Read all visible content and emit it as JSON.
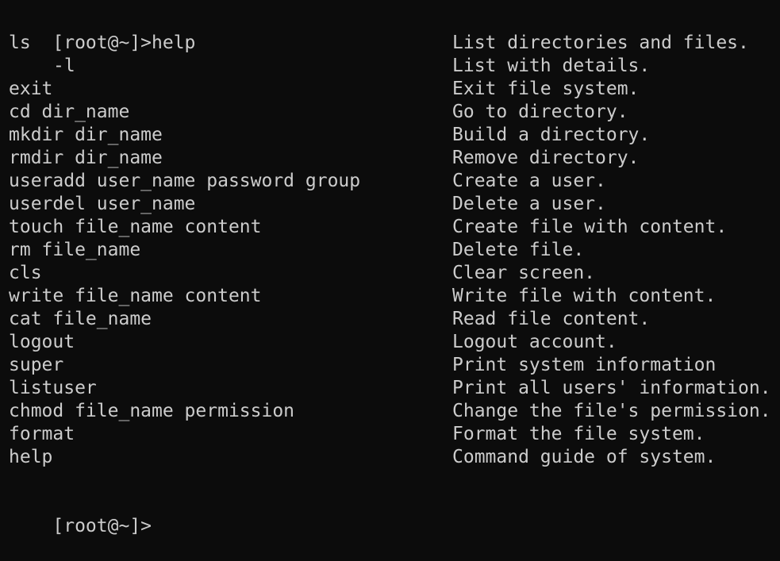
{
  "terminal": {
    "first_prompt": "[root@~]>",
    "first_command": "help",
    "last_prompt": "[root@~]>",
    "help_rows": [
      {
        "command": "ls",
        "description": "List directories and files."
      },
      {
        "command": "-l",
        "description": "List with details.",
        "indent": true
      },
      {
        "command": "exit",
        "description": "Exit file system."
      },
      {
        "command": "cd dir_name",
        "description": "Go to directory."
      },
      {
        "command": "mkdir dir_name",
        "description": "Build a directory."
      },
      {
        "command": "rmdir dir_name",
        "description": "Remove directory."
      },
      {
        "command": "useradd user_name password group",
        "description": "Create a user."
      },
      {
        "command": "userdel user_name",
        "description": "Delete a user."
      },
      {
        "command": "touch file_name content",
        "description": "Create file with content."
      },
      {
        "command": "rm file_name",
        "description": "Delete file."
      },
      {
        "command": "cls",
        "description": "Clear screen."
      },
      {
        "command": "write file_name content",
        "description": "Write file with content."
      },
      {
        "command": "cat file_name",
        "description": "Read file content."
      },
      {
        "command": "logout",
        "description": "Logout account."
      },
      {
        "command": "super",
        "description": "Print system information"
      },
      {
        "command": "listuser",
        "description": "Print all users' information."
      },
      {
        "command": "chmod file_name permission",
        "description": "Change the file's permission."
      },
      {
        "command": "format",
        "description": "Format the file system."
      },
      {
        "command": "help",
        "description": "Command guide of system."
      }
    ]
  },
  "colors": {
    "background": "#0c0c0c",
    "foreground": "#cccccc"
  }
}
